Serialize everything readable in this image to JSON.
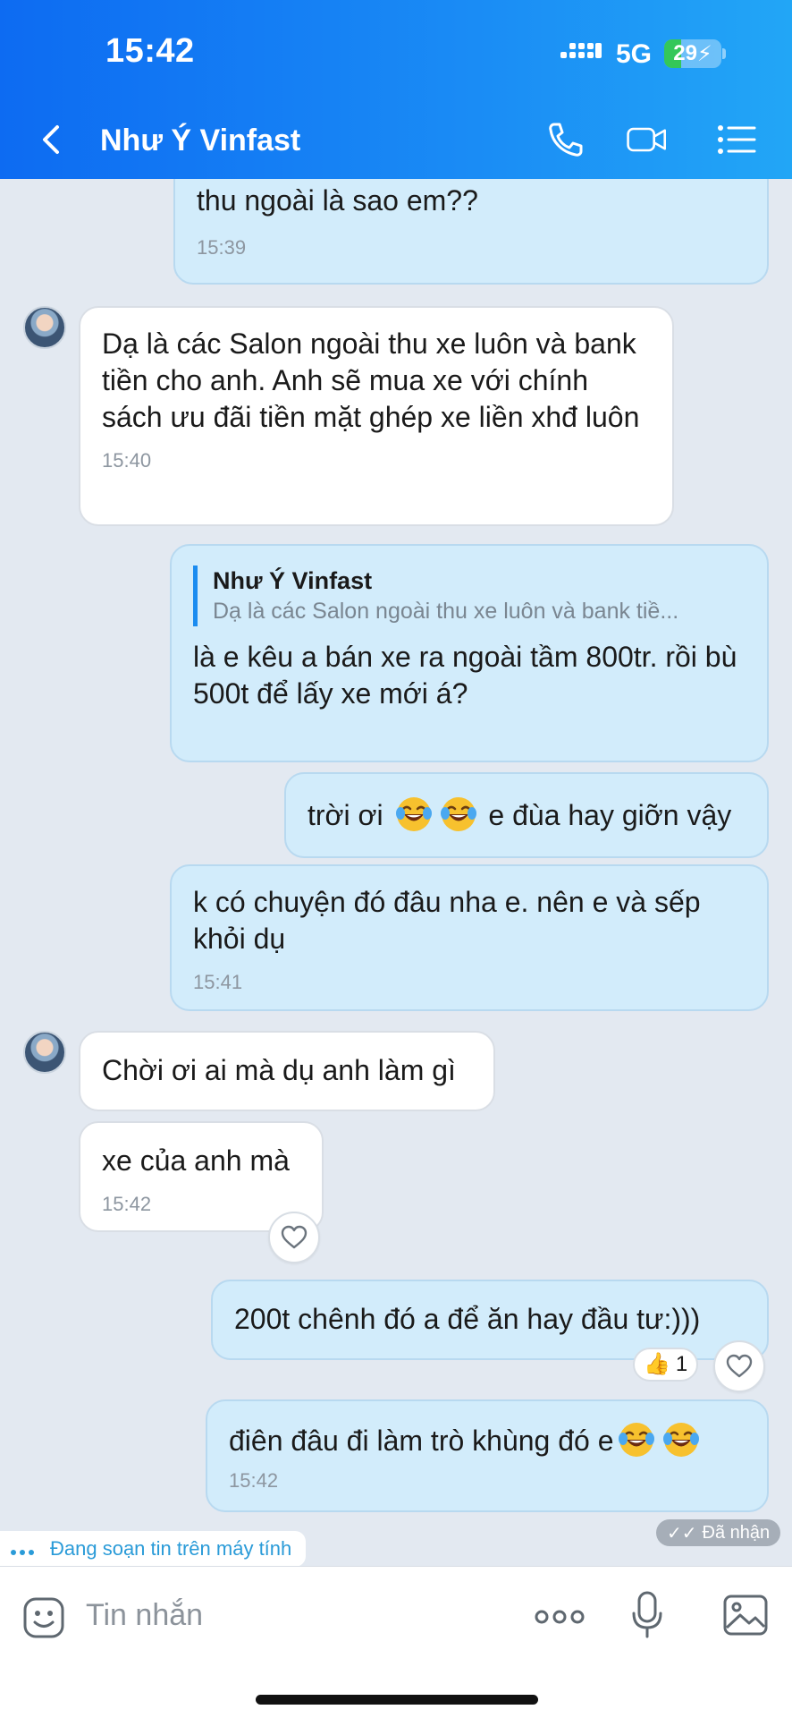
{
  "status_bar": {
    "time": "15:42",
    "network": "5G",
    "battery": "29",
    "battery_level": 0.29
  },
  "header": {
    "title": "Như Ý Vinfast"
  },
  "messages": [
    {
      "text": "thu ngoài là sao em??",
      "time": "15:39"
    },
    {
      "text": "Dạ là các Salon ngoài thu xe luôn và bank tiền cho anh. Anh sẽ mua xe với chính sách ưu đãi tiền mặt ghép xe liền xhđ luôn",
      "time": "15:40"
    },
    {
      "quote_name": "Như Ý Vinfast",
      "quote_text": "Dạ là các Salon ngoài thu xe luôn và bank tiề...",
      "text": "là e kêu a bán xe ra ngoài tầm 800tr. rồi bù 500t để lấy xe mới á?"
    },
    {
      "text_before": "trời ơi",
      "text_after": "e đùa hay giỡn vậy"
    },
    {
      "text": "k có chuyện đó đâu nha e. nên e và sếp khỏi dụ",
      "time": "15:41"
    },
    {
      "text": "Chời ơi ai mà dụ anh làm gì"
    },
    {
      "text": "xe của anh mà",
      "time": "15:42"
    },
    {
      "text": "200t chênh đó a để ăn hay đầu tư:)))",
      "reaction_count": "1"
    },
    {
      "text": "điên đâu đi làm trò khùng đó e",
      "time": "15:42"
    }
  ],
  "typing_indicator": "Đang soạn tin trên máy tính",
  "receipt": "Đã nhận",
  "input": {
    "placeholder": "Tin nhắn"
  },
  "icons": {
    "back": "chevron-left-icon",
    "call": "phone-icon",
    "video": "video-camera-icon",
    "menu": "list-menu-icon",
    "sticker": "sticker-icon",
    "more": "more-dots-icon",
    "mic": "microphone-icon",
    "gallery": "image-icon",
    "heart": "heart-icon",
    "like": "thumbs-up-icon",
    "laugh": "tears-of-joy-emoji"
  },
  "colors": {
    "header_start": "#0d6bf2",
    "header_end": "#22a6f6",
    "outgoing_bubble": "#d2ecfb",
    "incoming_bubble": "#ffffff",
    "accent": "#1b8cf0"
  }
}
